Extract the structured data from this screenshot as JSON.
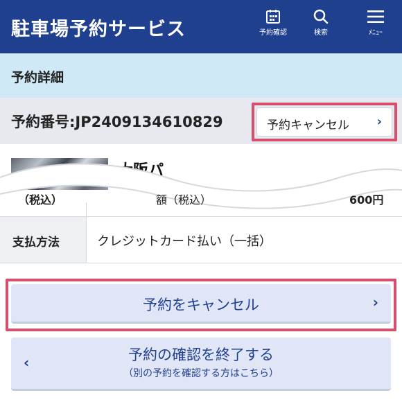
{
  "header": {
    "title": "駐車場予約サービス",
    "buttons": [
      {
        "label": "予約確認",
        "icon": "calendar-icon"
      },
      {
        "label": "検索",
        "icon": "search-icon"
      },
      {
        "label": "ﾒﾆｭｰ",
        "icon": "hamburger-menu-icon"
      }
    ]
  },
  "section": {
    "title": "予約詳細"
  },
  "reservation": {
    "number": "予約番号:JP2409134610829",
    "cancel_link": "予約キャンセル",
    "chevron": "›"
  },
  "parking": {
    "name_partial": "大阪パ"
  },
  "details": {
    "partial_label": "（税込）",
    "partial_mid": "額（税込）",
    "partial_value": "600円",
    "payment_label": "支払方法",
    "payment_value": "クレジットカード払い（一括）"
  },
  "actions": {
    "cancel_label": "予約をキャンセル",
    "cancel_chevron": "›",
    "end_label": "予約の確認を終了する",
    "end_sub": "（別の予約を確認する方はこちら）",
    "end_chevron": "‹"
  },
  "colors": {
    "header_bg": "#1f3f8f",
    "section_bg": "#cfe9f7",
    "highlight": "#d6506d",
    "button_bg": "#e0e6f5"
  }
}
